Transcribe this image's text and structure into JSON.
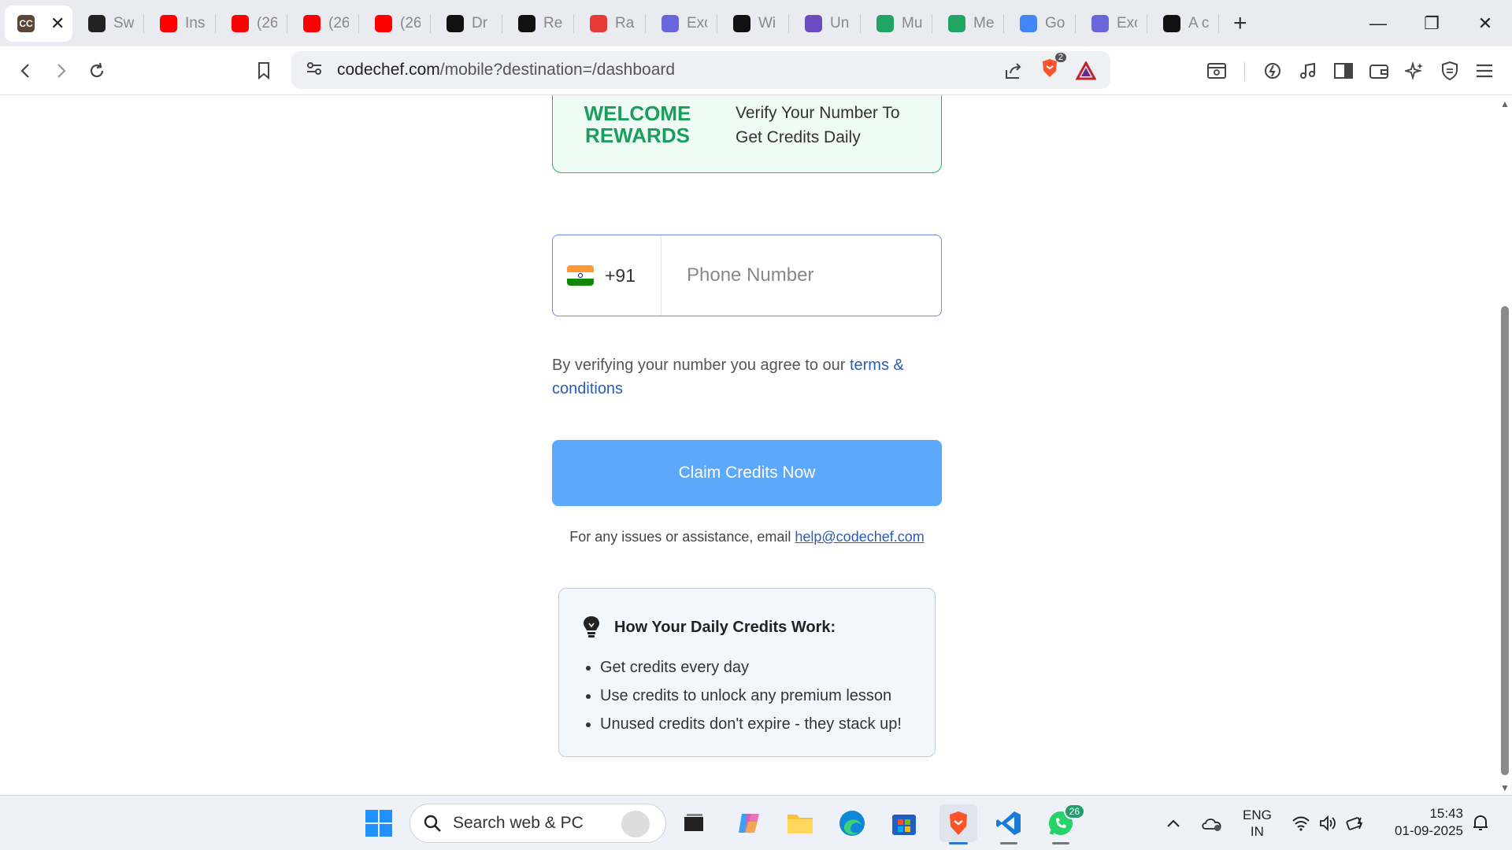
{
  "browser": {
    "tabs": [
      {
        "label": "CC",
        "icon": "codechef-icon",
        "color": "#5b4638",
        "active": true
      },
      {
        "label": "Sw",
        "icon": "openai-icon",
        "color": "#222222"
      },
      {
        "label": "Ins",
        "icon": "youtube-icon",
        "color": "#ff0000"
      },
      {
        "label": "(26",
        "icon": "youtube-icon",
        "color": "#ff0000"
      },
      {
        "label": "(26",
        "icon": "youtube-icon",
        "color": "#ff0000"
      },
      {
        "label": "(26",
        "icon": "youtube-icon",
        "color": "#ff0000"
      },
      {
        "label": "Dr",
        "icon": "play-icon",
        "color": "#111111"
      },
      {
        "label": "Re",
        "icon": "app-icon",
        "color": "#111111"
      },
      {
        "label": "Ra",
        "icon": "red-icon",
        "color": "#e53935"
      },
      {
        "label": "Exc",
        "icon": "excalidraw-icon",
        "color": "#6965db"
      },
      {
        "label": "Wi",
        "icon": "app-icon",
        "color": "#111111"
      },
      {
        "label": "Un",
        "icon": "list-icon",
        "color": "#6a4cc0"
      },
      {
        "label": "Mu",
        "icon": "sheets-icon",
        "color": "#1fa463"
      },
      {
        "label": "Me",
        "icon": "sheets-icon",
        "color": "#1fa463"
      },
      {
        "label": "Go",
        "icon": "google-icon",
        "color": "#4285f4"
      },
      {
        "label": "Exc",
        "icon": "excalidraw-icon",
        "color": "#6965db"
      },
      {
        "label": "A c",
        "icon": "app-icon",
        "color": "#111111"
      }
    ],
    "url_domain": "codechef.com",
    "url_path": "/mobile?destination=/dashboard",
    "shield_count": "2"
  },
  "page": {
    "rewards_title": "WELCOME REWARDS",
    "rewards_text": "Verify Your Number To Get Credits Daily",
    "country_code": "+91",
    "phone_placeholder": "Phone Number",
    "terms_prefix": "By verifying your number you agree to our ",
    "terms_link": "terms & conditions",
    "claim_button": "Claim Credits Now",
    "help_prefix": "For any issues or assistance, email ",
    "help_email": "help@codechef.com",
    "info_title": "How Your Daily Credits Work:",
    "info_items": [
      "Get credits every day",
      "Use credits to unlock any premium lesson",
      "Unused credits don't expire - they stack up!"
    ]
  },
  "taskbar": {
    "search_placeholder": "Search web & PC",
    "whatsapp_badge": "26",
    "lang_top": "ENG",
    "lang_bottom": "IN",
    "time": "15:43",
    "date": "01-09-2025"
  },
  "colors": {
    "accent_green": "#1a9e5c",
    "claim_button": "#5ca9fb",
    "link": "#2a5db0"
  }
}
